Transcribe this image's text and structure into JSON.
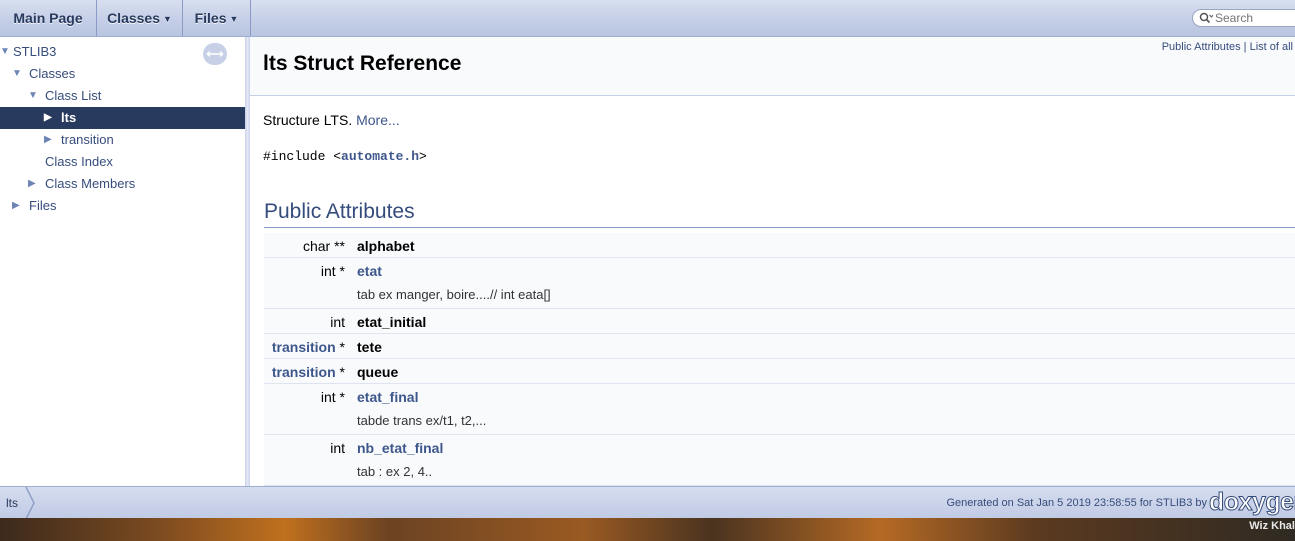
{
  "topnav": {
    "tabs": [
      {
        "label": "Main Page"
      },
      {
        "label": "Classes"
      },
      {
        "label": "Files"
      }
    ],
    "search_placeholder": "Search"
  },
  "sidenav": {
    "items": [
      {
        "label": "STLIB3"
      },
      {
        "label": "Classes"
      },
      {
        "label": "Class List"
      },
      {
        "label": "lts"
      },
      {
        "label": "transition"
      },
      {
        "label": "Class Index"
      },
      {
        "label": "Class Members"
      },
      {
        "label": "Files"
      }
    ]
  },
  "header": {
    "summary_link_1": "Public Attributes",
    "summary_sep": "|",
    "summary_link_2": "List of all",
    "title": "lts Struct Reference"
  },
  "content": {
    "brief_text": "Structure LTS.",
    "brief_more": "More...",
    "include_prefix": "#include <",
    "include_file": "automate.h",
    "include_suffix": ">",
    "group_heading": "Public Attributes",
    "members": [
      {
        "type_link": "",
        "type_text": "char **",
        "name": "alphabet",
        "linked": false,
        "desc": ""
      },
      {
        "type_link": "",
        "type_text": "int *",
        "name": "etat",
        "linked": true,
        "desc": "tab ex manger, boire....// int eata[]"
      },
      {
        "type_link": "",
        "type_text": "int",
        "name": "etat_initial",
        "linked": false,
        "desc": ""
      },
      {
        "type_link": "transition",
        "type_text": " *",
        "name": "tete",
        "linked": false,
        "desc": ""
      },
      {
        "type_link": "transition",
        "type_text": " *",
        "name": "queue",
        "linked": false,
        "desc": ""
      },
      {
        "type_link": "",
        "type_text": "int *",
        "name": "etat_final",
        "linked": true,
        "desc": "tabde trans ex/t1, t2,..."
      },
      {
        "type_link": "",
        "type_text": "int",
        "name": "nb_etat_final",
        "linked": true,
        "desc": "tab : ex 2, 4.."
      }
    ]
  },
  "footer": {
    "crumb": "lts",
    "generated": "Generated on Sat Jan 5 2019 23:58:55 for STLIB3 by",
    "logo": "doxygen"
  },
  "desktop": {
    "label": "Wiz Khal"
  }
}
